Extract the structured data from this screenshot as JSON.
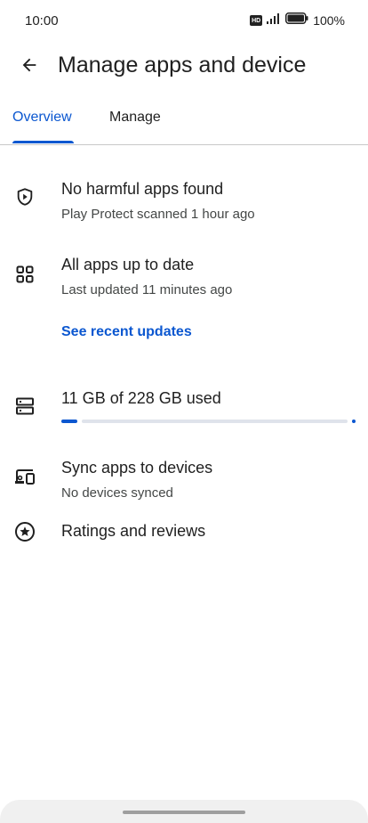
{
  "status_bar": {
    "time": "10:00",
    "hd_badge": "HD",
    "battery": "100%"
  },
  "header": {
    "title": "Manage apps and device",
    "back_icon": "arrow-back-icon"
  },
  "tabs": [
    {
      "label": "Overview",
      "selected": true
    },
    {
      "label": "Manage",
      "selected": false
    }
  ],
  "overview": {
    "protect": {
      "icon": "play-protect-shield-icon",
      "title": "No harmful apps found",
      "subtitle": "Play Protect scanned 1 hour ago"
    },
    "updates": {
      "icon": "apps-grid-icon",
      "title": "All apps up to date",
      "subtitle": "Last updated 11 minutes ago",
      "link": "See recent updates"
    },
    "storage": {
      "icon": "storage-icon",
      "title": "11 GB of 228 GB used",
      "used_gb": 11,
      "total_gb": 228
    },
    "sync": {
      "icon": "devices-icon",
      "title": "Sync apps to devices",
      "subtitle": "No devices synced"
    },
    "ratings": {
      "icon": "star-circle-icon",
      "title": "Ratings and reviews"
    }
  },
  "colors": {
    "accent": "#0b57d0",
    "text": "#1f1f1f",
    "secondary_text": "#444746",
    "track": "#dfe3eb"
  }
}
